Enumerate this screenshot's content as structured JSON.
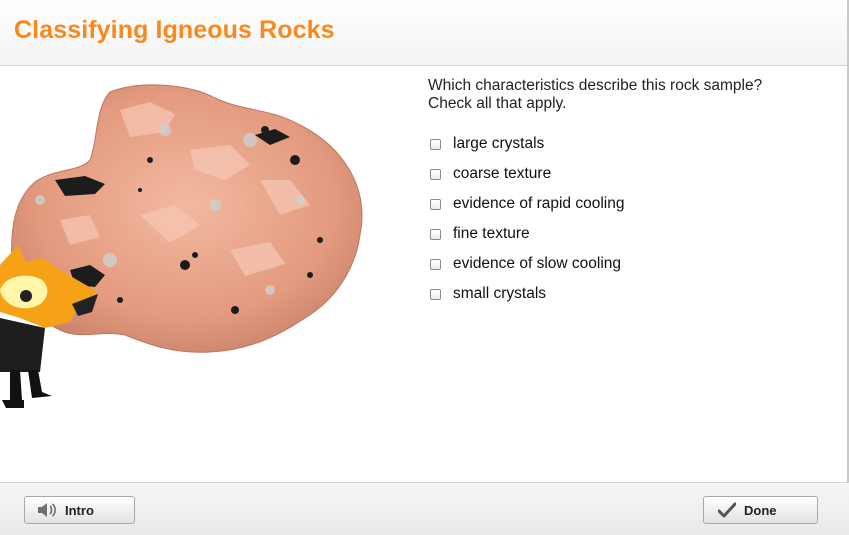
{
  "header": {
    "title": "Classifying Igneous Rocks"
  },
  "question": {
    "line1": "Which characteristics describe this rock sample?",
    "line2": "Check all that apply."
  },
  "options": [
    {
      "label": "large crystals",
      "checked": false
    },
    {
      "label": "coarse texture",
      "checked": false
    },
    {
      "label": "evidence of rapid cooling",
      "checked": false
    },
    {
      "label": "fine texture",
      "checked": false
    },
    {
      "label": "evidence of slow cooling",
      "checked": false
    },
    {
      "label": "small crystals",
      "checked": false
    }
  ],
  "footer": {
    "intro_label": "Intro",
    "intro_icon": "speaker-icon",
    "done_label": "Done",
    "done_icon": "checkmark-icon"
  },
  "colors": {
    "title": "#f7891e",
    "rock": "#e8a58b",
    "character": "#f5a216"
  }
}
